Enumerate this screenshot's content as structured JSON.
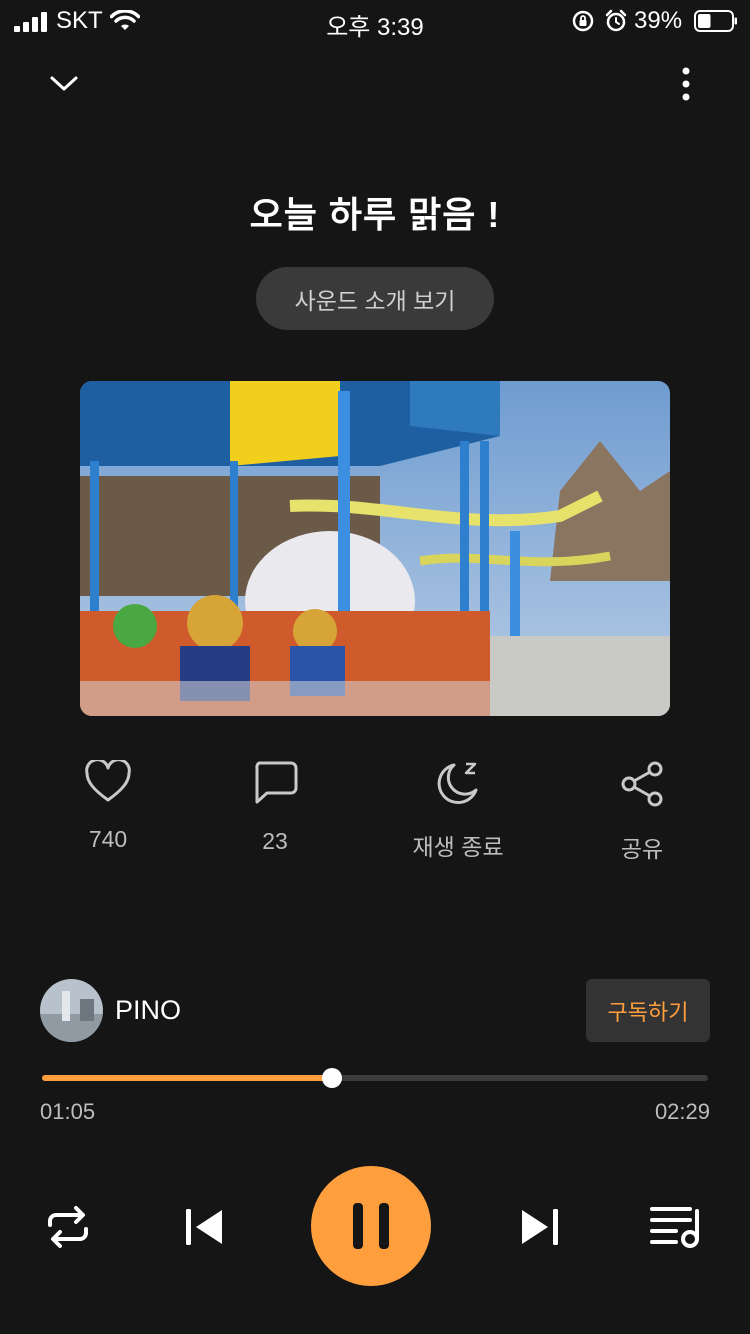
{
  "status_bar": {
    "carrier": "SKT",
    "time": "오후 3:39",
    "battery_percent": "39%",
    "battery_level": 0.39
  },
  "header": {
    "collapse_icon": "chevron-down-icon",
    "more_icon": "more-vertical-icon"
  },
  "track": {
    "title": "오늘 하루 맑음 !",
    "intro_button": "사운드 소개 보기",
    "cover_description_icon": "cover-image"
  },
  "actions": {
    "like_count": "740",
    "comment_count": "23",
    "sleep_label": "재생 종료",
    "share_label": "공유"
  },
  "artist": {
    "name": "PINO",
    "subscribe_label": "구독하기"
  },
  "progress": {
    "current": "01:05",
    "total": "02:29",
    "fraction": 0.436
  },
  "colors": {
    "accent": "#ff9e3d",
    "background": "#151515"
  }
}
